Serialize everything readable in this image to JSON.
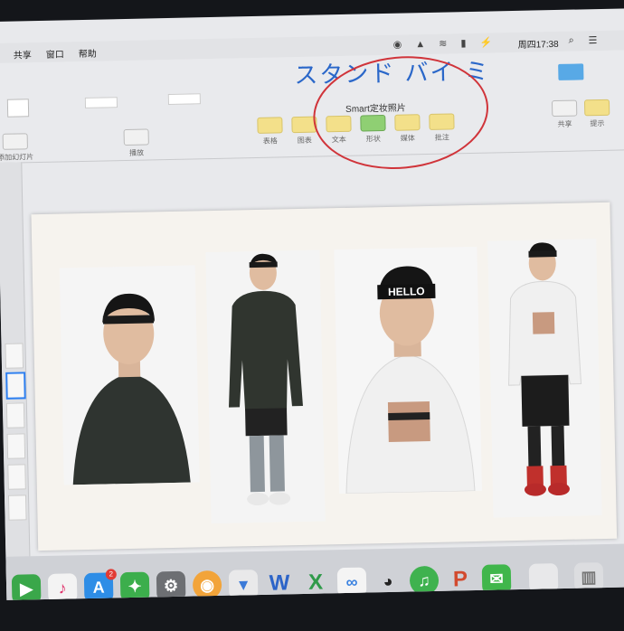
{
  "menubar": {
    "items": [
      "共享",
      "窗口",
      "帮助"
    ],
    "clock": "周四17:38"
  },
  "annotation": {
    "handwritten_title": "スタンド バイ ミ"
  },
  "document": {
    "title": "Smart定妆照片"
  },
  "toolbar": {
    "left_partial_label": "添加幻灯片",
    "play_label": "播放",
    "buttons": [
      "表格",
      "图表",
      "文本",
      "形状",
      "媒体",
      "批注"
    ],
    "right_buttons": [
      "共享",
      "提示"
    ]
  },
  "slide": {
    "photos": [
      {
        "headband_text": "",
        "shirt": "black hoodie, headshot"
      },
      {
        "headband_text": "",
        "shirt": "black hoodie, full length"
      },
      {
        "headband_text": "HELLO",
        "shirt": "white hoodie, headshot"
      },
      {
        "headband_text": "",
        "shirt": "white hoodie, full length"
      }
    ]
  },
  "dock": {
    "icons": [
      "facetime-icon",
      "itunes-icon",
      "app-store-icon",
      "maps-icon",
      "system-preferences-icon",
      "ibooks-icon",
      "keynote-icon",
      "word-icon",
      "excel-icon",
      "baidu-netdisk-icon",
      "qq-icon",
      "music-icon",
      "powerpoint-icon",
      "wechat-icon",
      "documents-icon",
      "trash-icon"
    ],
    "badge": "2"
  }
}
